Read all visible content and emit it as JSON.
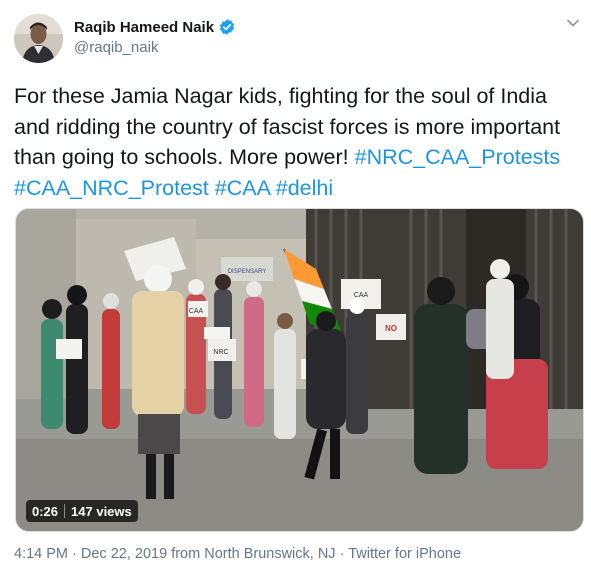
{
  "author": {
    "display_name": "Raqib Hameed Naik",
    "handle": "@raqib_naik",
    "verified": true
  },
  "tweet": {
    "text_plain": "For these Jamia Nagar kids, fighting for the soul of India and ridding the country of fascist forces is more important than going to schools. More power! ",
    "hashtags": [
      "#NRC_CAA_Protests",
      "#CAA_NRC_Protest",
      "#CAA",
      "#delhi"
    ]
  },
  "video": {
    "duration": "0:26",
    "views": "147 views",
    "sign_texts": [
      "CAA",
      "NRC",
      "NO",
      "CAA",
      "NO",
      "DISPENSARY"
    ]
  },
  "footer": {
    "time": "4:14 PM",
    "date": "Dec 22, 2019",
    "location": "from North Brunswick, NJ",
    "source": "Twitter for iPhone",
    "separator": " · "
  },
  "icons": {
    "verified": "verified-badge-icon",
    "menu": "chevron-down-icon"
  },
  "colors": {
    "link": "#1b95e0",
    "secondary": "#657786",
    "verified": "#1da1f2"
  }
}
